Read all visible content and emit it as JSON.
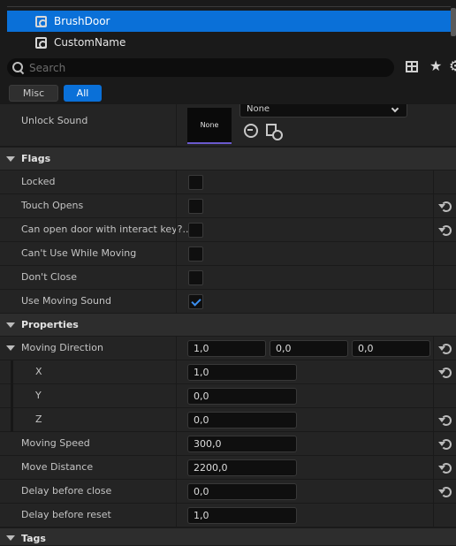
{
  "tree": {
    "items": [
      {
        "label": "BrushDoor",
        "selected": true
      },
      {
        "label": "CustomName",
        "selected": false
      }
    ]
  },
  "search": {
    "placeholder": "Search"
  },
  "filters": {
    "misc": "Misc",
    "all": "All"
  },
  "unlock_sound": {
    "label": "Unlock Sound",
    "thumbnail": "None",
    "value": "None"
  },
  "flags": {
    "title": "Flags",
    "items": [
      {
        "label": "Locked",
        "checked": false,
        "reset": false
      },
      {
        "label": "Touch Opens",
        "checked": false,
        "reset": true
      },
      {
        "label": "Can open door with interact key?...",
        "checked": false,
        "reset": true
      },
      {
        "label": "Can't Use While Moving",
        "checked": false,
        "reset": false
      },
      {
        "label": "Don't Close",
        "checked": false,
        "reset": false
      },
      {
        "label": "Use Moving Sound",
        "checked": true,
        "reset": false
      }
    ]
  },
  "properties": {
    "title": "Properties",
    "moving_direction": {
      "label": "Moving Direction",
      "x": "1,0",
      "y": "0,0",
      "z": "0,0"
    },
    "x_label": "X",
    "x_value": "1,0",
    "y_label": "Y",
    "y_value": "0,0",
    "z_label": "Z",
    "z_value": "0,0",
    "moving_speed": {
      "label": "Moving Speed",
      "value": "300,0"
    },
    "move_distance": {
      "label": "Move Distance",
      "value": "2200,0"
    },
    "delay_before_close": {
      "label": "Delay before close",
      "value": "0,0"
    },
    "delay_before_reset": {
      "label": "Delay before reset",
      "value": "1,0"
    }
  },
  "tags": {
    "title": "Tags"
  },
  "colors": {
    "accent": "#0a70d8",
    "checkmark": "#3b8ff0",
    "background": "#1a1a1a",
    "row": "#242424",
    "category": "#2d2d2d"
  }
}
